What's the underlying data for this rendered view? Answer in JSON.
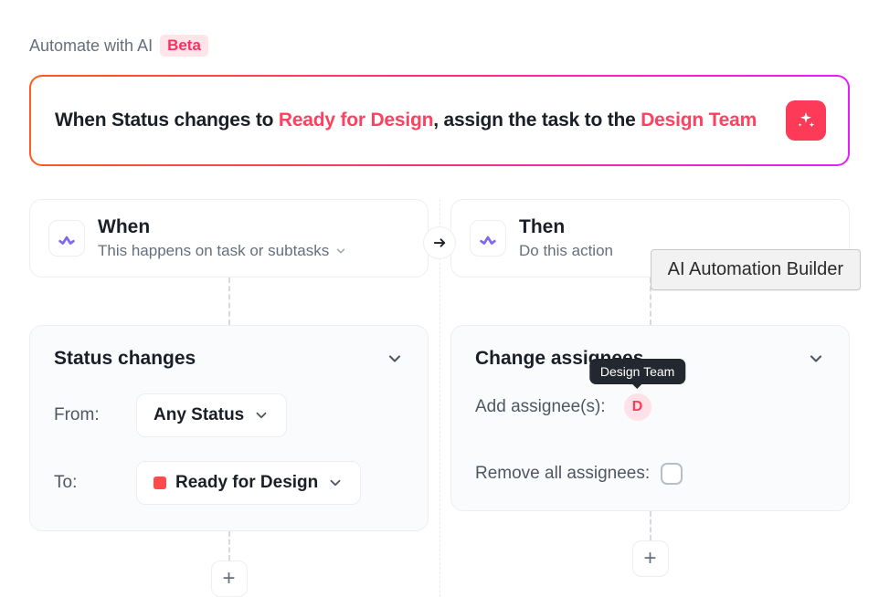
{
  "header": {
    "title": "Automate with AI",
    "badge": "Beta"
  },
  "prompt": {
    "part1": "When Status changes to ",
    "hl1": "Ready for Design",
    "part2": ", assign the task to the ",
    "hl2": "Design Team"
  },
  "when": {
    "title": "When",
    "subtitle": "This happens on task or subtasks",
    "condition_label": "Status changes",
    "from_label": "From:",
    "from_value": "Any Status",
    "to_label": "To:",
    "to_value": "Ready for Design"
  },
  "then": {
    "title": "Then",
    "subtitle": "Do this action",
    "action_label": "Change assignees",
    "add_label": "Add assignee(s):",
    "assignee_initial": "D",
    "assignee_tooltip": "Design Team",
    "remove_label": "Remove all assignees:"
  },
  "tooltip_panel": "AI Automation Builder",
  "icons": {
    "plus": "+"
  }
}
